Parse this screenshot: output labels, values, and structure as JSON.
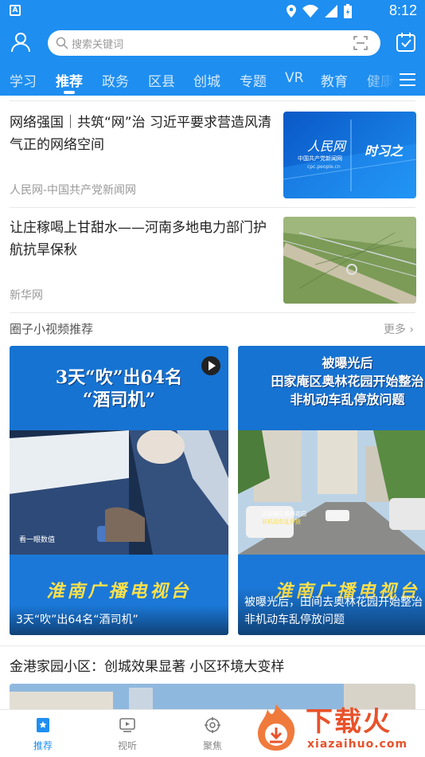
{
  "status_bar": {
    "time": "8:12"
  },
  "search": {
    "placeholder": "搜索关键词"
  },
  "tabs": [
    {
      "label": "学习"
    },
    {
      "label": "推荐"
    },
    {
      "label": "政务"
    },
    {
      "label": "区县"
    },
    {
      "label": "创城"
    },
    {
      "label": "专题"
    },
    {
      "label": "VR"
    },
    {
      "label": "教育"
    },
    {
      "label": "健康"
    }
  ],
  "active_tab": "推荐",
  "articles": [
    {
      "title": "网络强国｜共筑“网”治 习近平要求营造风清气正的网络空间",
      "source": "人民网-中国共产党新闻网",
      "thumb": {
        "logo_text": "人民网",
        "sub_text": "中国共产党新闻网",
        "url_text": "cpc.people.cn",
        "tag_text": "时习之"
      }
    },
    {
      "title": "让庄稼喝上甘甜水——河南多地电力部门护航抗旱保秋",
      "source": "新华网"
    }
  ],
  "video_section": {
    "title": "圈子小视频推荐",
    "more": "更多",
    "videos": [
      {
        "headline_line1": "3天“吹”出64名",
        "headline_line2": "“酒司机”",
        "photo_label": "看一眼数值",
        "station": "淮南广播电视台",
        "caption": "3天“吹”出64名“酒司机”"
      },
      {
        "headline_line1": "被曝光后",
        "headline_line2": "田家庵区奥林花园开始整治",
        "headline_line3": "非机动车乱停放问题",
        "photo_sign_line1": "田家庵区奥林花园",
        "photo_sign_line2": "非机动车乱停放",
        "station": "淮南广播电视台",
        "caption": "被曝光后，田间去奥林花园开始整治非机动车乱停放问题"
      }
    ]
  },
  "article3": {
    "title": "金港家园小区：创城效果显著 小区环境大变样"
  },
  "bottom_nav": [
    {
      "label": "推荐"
    },
    {
      "label": "视听"
    },
    {
      "label": "聚焦"
    }
  ],
  "watermark": {
    "title": "下载火",
    "url": "xiazaihuo.com"
  },
  "colors": {
    "primary": "#1e8ef0",
    "station_yellow": "#ffe14a",
    "watermark": "#e8522a"
  }
}
